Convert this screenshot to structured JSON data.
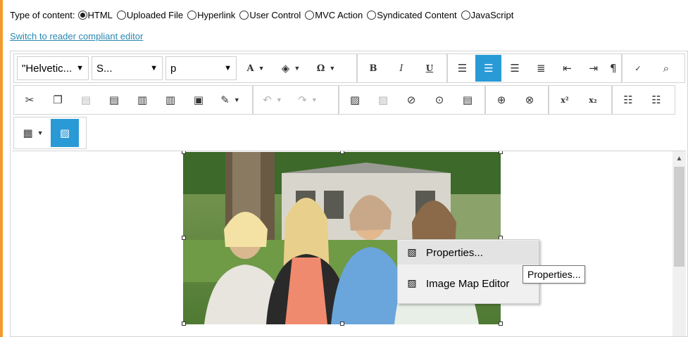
{
  "content_type": {
    "label": "Type of content:",
    "options": [
      {
        "label": "HTML",
        "checked": true
      },
      {
        "label": "Uploaded File",
        "checked": false
      },
      {
        "label": "Hyperlink",
        "checked": false
      },
      {
        "label": "User Control",
        "checked": false
      },
      {
        "label": "MVC Action",
        "checked": false
      },
      {
        "label": "Syndicated Content",
        "checked": false
      },
      {
        "label": "JavaScript",
        "checked": false
      }
    ]
  },
  "switch_link": "Switch to reader compliant editor",
  "toolbar": {
    "font_family": "\"Helvetic...",
    "font_size": "S...",
    "paragraph_format": "p",
    "bold": "B",
    "italic": "I",
    "underline": "U",
    "superscript": "x²",
    "subscript": "x₂"
  },
  "context_menu": {
    "items": [
      {
        "label": "Properties...",
        "icon": "properties-icon"
      },
      {
        "label": "Image Map Editor",
        "icon": "image-map-icon"
      }
    ]
  },
  "tooltip": "Properties...",
  "colors": {
    "accent": "#2a9ad7",
    "link": "#2a87b3",
    "left_bar": "#f39a2d"
  }
}
